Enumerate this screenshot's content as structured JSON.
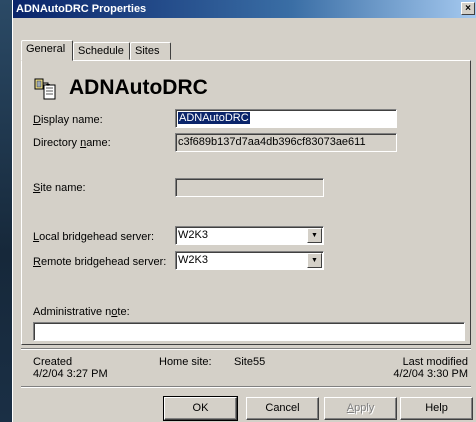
{
  "window": {
    "title": "ADNAutoDRC Properties",
    "close_glyph": "×"
  },
  "tabs": [
    "General",
    "Schedule",
    "Sites"
  ],
  "header": {
    "object_name": "ADNAutoDRC",
    "icon": "connection-object-icon"
  },
  "form": {
    "display_name": {
      "label_u": "D",
      "label_rest": "isplay name:",
      "value": "ADNAutoDRC"
    },
    "directory_name": {
      "label_pre": "Directory ",
      "label_u": "n",
      "label_post": "ame:",
      "value": "c3f689b137d7aa4db396cf83073ae611"
    },
    "site_name": {
      "label_u": "S",
      "label_rest": "ite name:",
      "value": ""
    },
    "local_bridgehead": {
      "label_u": "L",
      "label_rest": "ocal bridgehead server:",
      "value": "W2K3"
    },
    "remote_bridgehead": {
      "label_u": "R",
      "label_rest": "emote bridgehead server:",
      "value": "W2K3"
    },
    "admin_note": {
      "label_pre": "Administrative n",
      "label_u": "o",
      "label_post": "te:",
      "value": ""
    }
  },
  "footer": {
    "created_label": "Created",
    "created_value": "4/2/04  3:27 PM",
    "home_site_label": "Home site:",
    "home_site_value": "Site55",
    "modified_label": "Last modified",
    "modified_value": "4/2/04  3:30 PM"
  },
  "buttons": {
    "ok": "OK",
    "cancel": "Cancel",
    "apply_u": "A",
    "apply_rest": "pply",
    "help": "Help"
  },
  "colors": {
    "title_start": "#0a246a",
    "dialog_bg": "#d4d0c8",
    "selection": "#0a246a"
  }
}
